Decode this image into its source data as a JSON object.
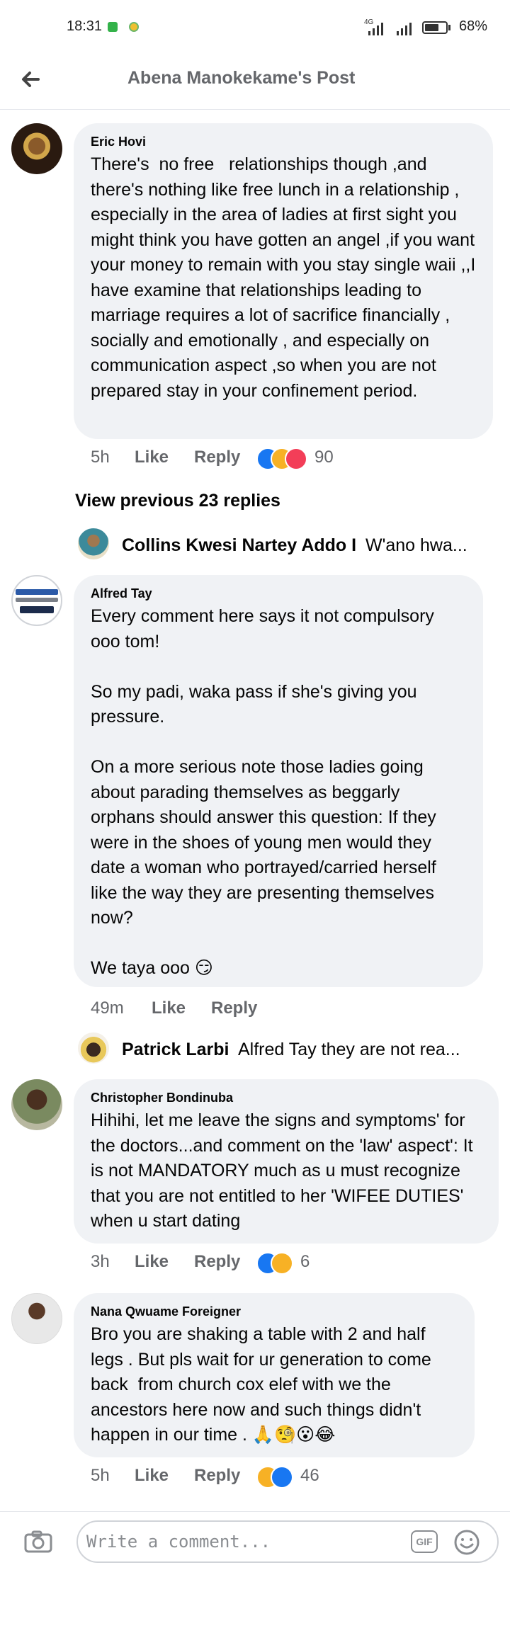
{
  "status_bar": {
    "time": "18:31",
    "network": "4G",
    "battery_percent": "68%",
    "battery_level": 0.68
  },
  "header": {
    "title": "Abena Manokekame's Post",
    "back_icon": "arrow-left-icon"
  },
  "comments": [
    {
      "author": "Eric Hovi",
      "text": "There's  no free   relationships though ,and there's nothing like free lunch in a relationship , especially in the area of ladies at first sight you might think you have gotten an angel ,if you want your money to remain with you stay single waii ,,I have examine that relationships leading to marriage requires a lot of sacrifice financially , socially and emotionally , and especially on communication aspect ,so when you are not prepared stay in your confinement period.",
      "time": "5h",
      "like_label": "Like",
      "reply_label": "Reply",
      "reaction_icons": [
        "like-icon",
        "haha-icon",
        "love-icon"
      ],
      "reaction_count": "90"
    },
    {
      "author": "Alfred Tay",
      "text": "Every comment here says it not compulsory ooo tom!\n\nSo my padi, waka pass if she's giving you pressure.\n\nOn a more serious note those ladies going about parading themselves as beggarly orphans should answer this question: If they were in the shoes of young men would they date a woman who portrayed/carried herself like the way they are presenting themselves now?\n\nWe taya ooo 😏",
      "time": "49m",
      "like_label": "Like",
      "reply_label": "Reply"
    },
    {
      "author": "Christopher Bondinuba",
      "text": "Hihihi, let me leave the signs and symptoms' for the doctors...and comment on the 'law' aspect': It is not MANDATORY much as u must recognize that you are not entitled to her 'WIFEE DUTIES' when u start dating",
      "time": "3h",
      "like_label": "Like",
      "reply_label": "Reply",
      "reaction_icons": [
        "like-icon",
        "haha-icon"
      ],
      "reaction_count": "6"
    },
    {
      "author": "Nana Qwuame Foreigner",
      "text": "Bro you are shaking a table with 2 and half legs . But pls wait for ur generation to come back  from church cox elef with we the ancestors here now and such things didn't happen in our time . 🙏🧐😮😂",
      "time": "5h",
      "like_label": "Like",
      "reply_label": "Reply",
      "reaction_icons": [
        "haha-icon",
        "like-icon"
      ],
      "reaction_count": "46"
    }
  ],
  "view_previous": "View previous 23 replies",
  "replies_preview": [
    {
      "name": "Collins Kwesi Nartey Addo I",
      "text": "W'ano hwa..."
    },
    {
      "name": "Patrick Larbi",
      "text": "Alfred Tay they are not rea..."
    }
  ],
  "composer": {
    "placeholder": "Write a comment...",
    "gif_label": "GIF",
    "camera_icon": "camera-icon",
    "emoji_icon": "smiley-icon"
  },
  "colors": {
    "bubble": "#f0f2f5",
    "meta_text": "#65676b",
    "like_blue": "#1877f2",
    "haha_yellow": "#f7b125",
    "love_red": "#f33e58"
  }
}
